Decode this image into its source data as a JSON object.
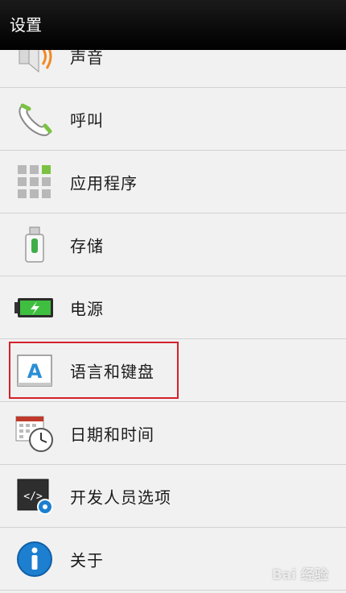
{
  "header": {
    "title": "设置"
  },
  "settings": {
    "items": [
      {
        "label": "声音",
        "icon": "speaker-icon"
      },
      {
        "label": "呼叫",
        "icon": "phone-icon"
      },
      {
        "label": "应用程序",
        "icon": "apps-grid-icon"
      },
      {
        "label": "存储",
        "icon": "usb-storage-icon"
      },
      {
        "label": "电源",
        "icon": "battery-icon"
      },
      {
        "label": "语言和键盘",
        "icon": "language-keyboard-icon"
      },
      {
        "label": "日期和时间",
        "icon": "calendar-clock-icon"
      },
      {
        "label": "开发人员选项",
        "icon": "developer-code-icon"
      },
      {
        "label": "关于",
        "icon": "info-icon"
      }
    ]
  },
  "watermark": {
    "text": "Bai 经验"
  },
  "colors": {
    "highlight": "#d4212a",
    "accent_green": "#7cc242",
    "info_blue": "#1d7fd0"
  }
}
